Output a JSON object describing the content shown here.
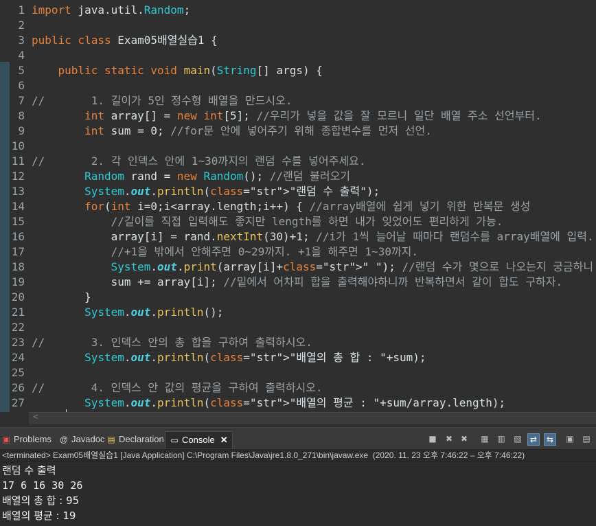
{
  "editor": {
    "line_numbers": [
      "1",
      "2",
      "3",
      "4",
      "5",
      "6",
      "7",
      "8",
      "9",
      "10",
      "11",
      "12",
      "13",
      "14",
      "15",
      "16",
      "17",
      "18",
      "19",
      "20",
      "21",
      "22",
      "23",
      "24",
      "25",
      "26",
      "27"
    ],
    "lines": [
      "import java.util.Random;",
      "",
      "public class Exam05배열실습1 {",
      "",
      "    public static void main(String[] args) {",
      "",
      "//       1. 길이가 5인 정수형 배열을 만드시오.",
      "        int array[] = new int[5]; //우리가 넣을 값을 잘 모르니 일단 배열 주소 선언부터.",
      "        int sum = 0; //for문 안에 넣어주기 위해 종합변수를 먼저 선언.",
      "",
      "//       2. 각 인덱스 안에 1~30까지의 랜덤 수를 넣어주세요.",
      "        Random rand = new Random(); //랜덤 불러오기",
      "        System.out.println(\"랜덤 수 출력\");",
      "        for(int i=0;i<array.length;i++) { //array배열에 쉽게 넣기 위한 반복문 생성",
      "            //길이를 직접 입력해도 좋지만 length를 하면 내가 잊었어도 편리하게 가능.",
      "            array[i] = rand.nextInt(30)+1; //i가 1씩 늘어날 때마다 랜덤수를 array배열에 입력.",
      "            //+1을 밖에서 안해주면 0~29까지. +1을 해주면 1~30까지.",
      "            System.out.print(array[i]+\" \"); //랜덤 수가 몇으로 나오는지 궁금하니 출력.",
      "            sum += array[i]; //밑에서 어차피 합을 출력해야하니까 반복하면서 같이 합도 구하자.",
      "        }",
      "        System.out.println();",
      "",
      "//       3. 인덱스 안의 총 합을 구하여 출력하시오.",
      "        System.out.println(\"배열의 총 합 : \"+sum);",
      "",
      "//       4. 인덱스 안 값의 평균을 구하여 출력하시오.",
      "        System.out.println(\"배열의 평균 : \"+sum/array.length);"
    ]
  },
  "panel": {
    "tabs": [
      {
        "label": "Problems",
        "icon": "problems-icon"
      },
      {
        "label": "Javadoc",
        "icon": "javadoc-icon"
      },
      {
        "label": "Declaration",
        "icon": "declaration-icon"
      },
      {
        "label": "Console",
        "icon": "console-icon",
        "active": true
      }
    ],
    "status": "<terminated> Exam05배열실습1 [Java Application] C:\\Program Files\\Java\\jre1.8.0_271\\bin\\javaw.exe  (2020. 11. 23 오후 7:46:22 – 오후 7:46:22)",
    "output": [
      "랜덤 수 출력",
      "17 6 16 30 26 ",
      "배열의 총 합 : 95",
      "배열의 평균 : 19"
    ]
  },
  "colors": {
    "background": "#2f2f2f",
    "keyword": "#e8813a",
    "class": "#2ecbd4",
    "method": "#e8c35a",
    "comment": "#9aa1a5"
  }
}
